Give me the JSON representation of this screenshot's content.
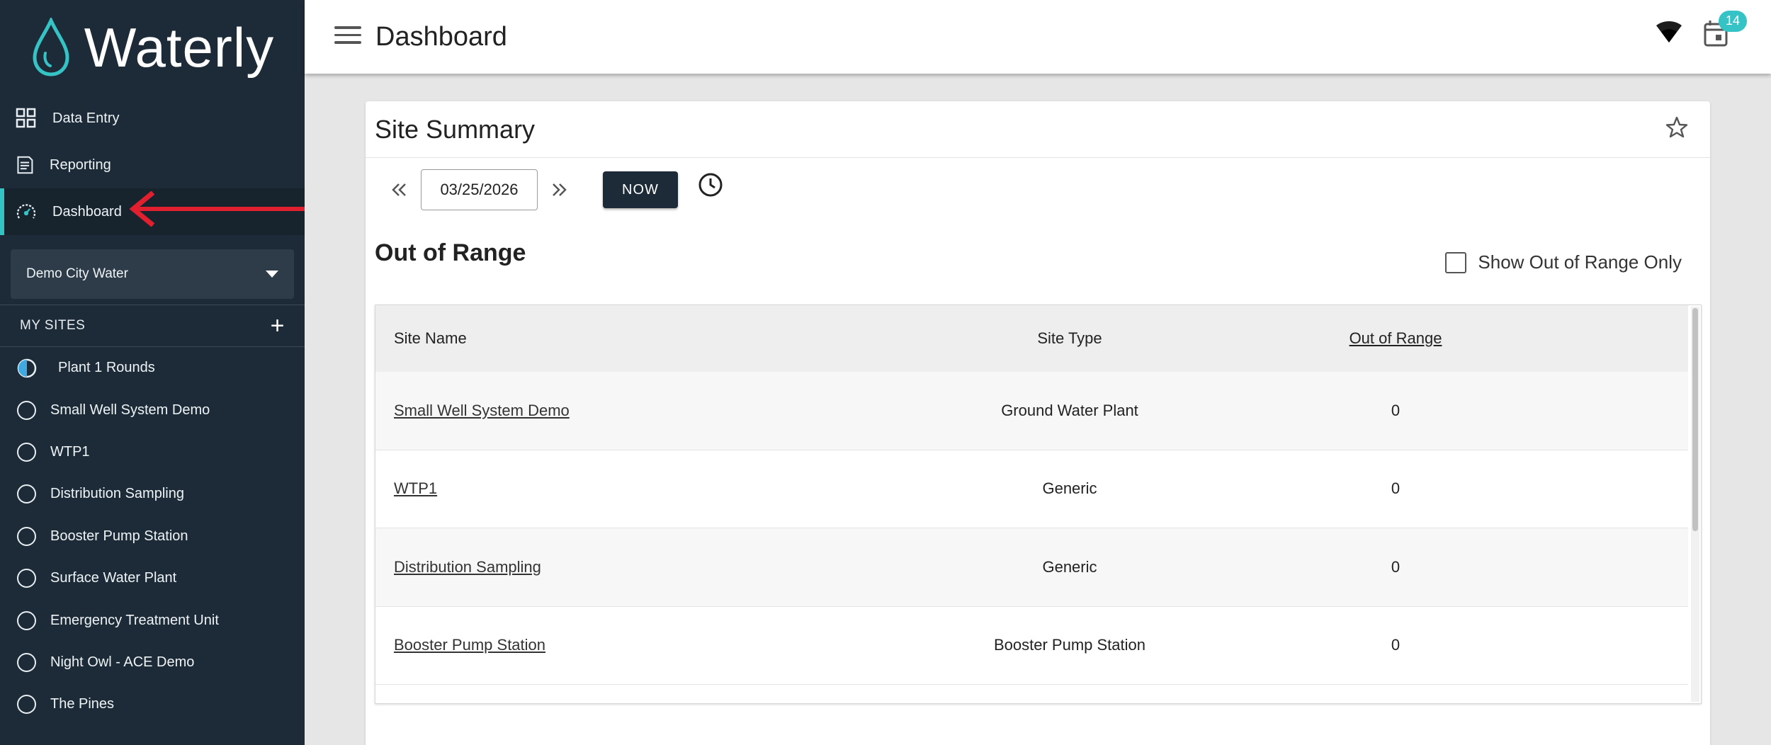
{
  "brand": {
    "name": "Waterly"
  },
  "nav": [
    {
      "label": "Data Entry",
      "icon": "grid-icon"
    },
    {
      "label": "Reporting",
      "icon": "report-icon"
    },
    {
      "label": "Dashboard",
      "icon": "speedometer-icon",
      "active": true
    }
  ],
  "org_select": {
    "value": "Demo City Water"
  },
  "my_sites": {
    "heading": "MY SITES",
    "add_label": "+",
    "items": [
      {
        "label": "Plant 1 Rounds",
        "icon": "half-circle-icon"
      },
      {
        "label": "Small Well System Demo",
        "icon": "circle-icon"
      },
      {
        "label": "WTP1",
        "icon": "circle-icon"
      },
      {
        "label": "Distribution Sampling",
        "icon": "circle-icon"
      },
      {
        "label": "Booster Pump Station",
        "icon": "circle-icon"
      },
      {
        "label": "Surface Water Plant",
        "icon": "circle-icon"
      },
      {
        "label": "Emergency Treatment Unit",
        "icon": "circle-icon"
      },
      {
        "label": "Night Owl - ACE Demo",
        "icon": "circle-icon"
      },
      {
        "label": "The Pines",
        "icon": "circle-icon"
      }
    ]
  },
  "topbar": {
    "title": "Dashboard",
    "notification_count": "14"
  },
  "card": {
    "title": "Site Summary",
    "date": "03/25/2026",
    "now_label": "NOW",
    "section_title": "Out of Range",
    "filter_label": "Show Out of Range Only",
    "table": {
      "headers": {
        "name": "Site Name",
        "type": "Site Type",
        "oor": "Out of Range"
      },
      "rows": [
        {
          "name": "Small Well System Demo",
          "type": "Ground Water Plant",
          "oor": "0"
        },
        {
          "name": "WTP1",
          "type": "Generic",
          "oor": "0"
        },
        {
          "name": "Distribution Sampling",
          "type": "Generic",
          "oor": "0"
        },
        {
          "name": "Booster Pump Station",
          "type": "Booster Pump Station",
          "oor": "0"
        }
      ]
    }
  },
  "colors": {
    "sidebar": "#1c2b37",
    "accent": "#35c3c5",
    "arrow": "#e0202e"
  }
}
